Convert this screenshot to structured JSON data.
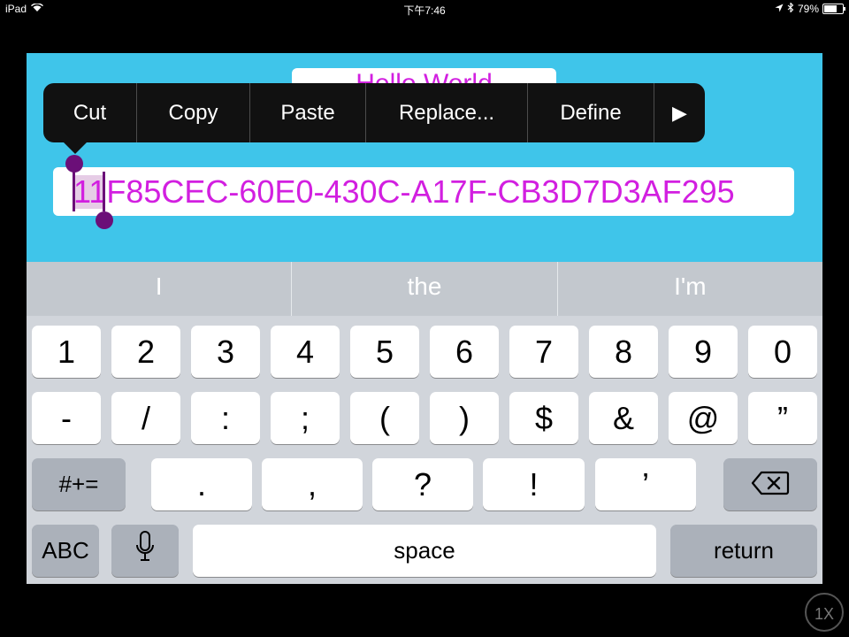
{
  "status_bar": {
    "device": "iPad",
    "time": "下午7:46",
    "battery": "79%",
    "battery_level": 0.79,
    "icons": [
      "wifi-icon",
      "location-icon",
      "bluetooth-icon",
      "battery-icon"
    ]
  },
  "app": {
    "label_text": "Hello World",
    "field_value": "11F85CEC-60E0-430C-A17F-CB3D7D3AF295",
    "background_color": "#3fc5ea",
    "text_color": "#d21fe0"
  },
  "edit_menu": {
    "items": [
      "Cut",
      "Copy",
      "Paste",
      "Replace...",
      "Define"
    ],
    "more": "▶"
  },
  "predictive": [
    "I",
    "the",
    "I'm"
  ],
  "keyboard": {
    "row1": [
      "1",
      "2",
      "3",
      "4",
      "5",
      "6",
      "7",
      "8",
      "9",
      "0"
    ],
    "row2": [
      "-",
      "/",
      ":",
      ";",
      "(",
      ")",
      "$",
      "&",
      "@",
      "”"
    ],
    "row3": [
      "#+=",
      ".",
      ",",
      "?",
      "!",
      "’"
    ],
    "row4": {
      "abc": "ABC",
      "space": "space",
      "return": "return"
    },
    "icons": [
      "backspace-icon",
      "microphone-icon"
    ]
  },
  "zoom_badge": "1X"
}
